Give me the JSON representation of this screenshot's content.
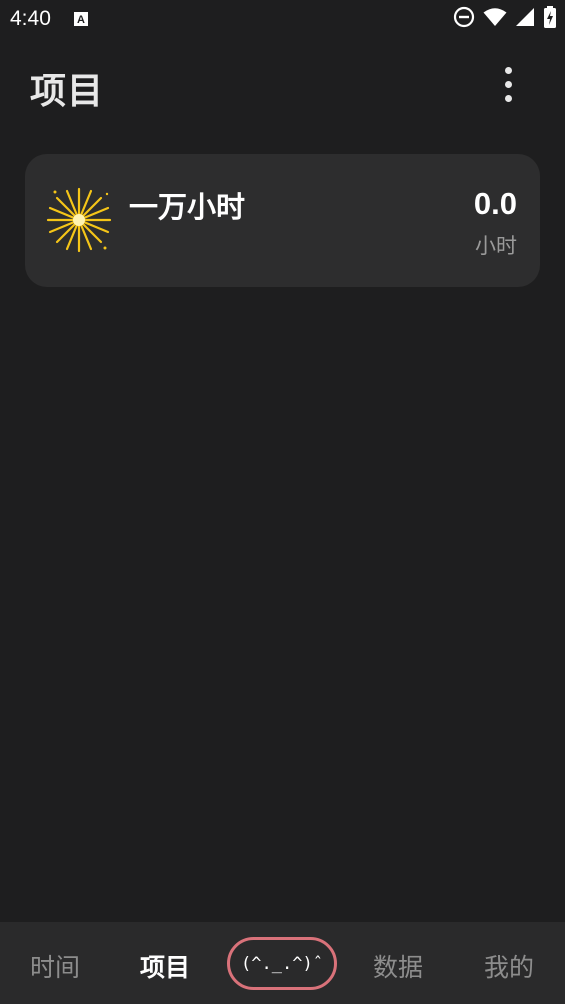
{
  "status_bar": {
    "time": "4:40",
    "icons": [
      "notification-a-icon",
      "do-not-disturb-icon",
      "wifi-icon",
      "signal-icon",
      "battery-charging-icon"
    ]
  },
  "header": {
    "title": "项目",
    "menu_icon": "more-vert-icon"
  },
  "projects": [
    {
      "name": "一万小时",
      "hours": "0.0",
      "unit": "小时",
      "icon": "sparkler-icon",
      "icon_color": "#f5c518"
    }
  ],
  "bottom_nav": {
    "items": [
      {
        "label": "时间",
        "active": false
      },
      {
        "label": "项目",
        "active": true
      },
      {
        "label": "(^._.^)ˆ",
        "active": false
      },
      {
        "label": "数据",
        "active": false
      },
      {
        "label": "我的",
        "active": false
      }
    ],
    "center_border_color": "#d9727a"
  },
  "colors": {
    "background": "#1e1e1f",
    "card": "#2d2d2e",
    "nav_background": "#2a2a2b"
  }
}
